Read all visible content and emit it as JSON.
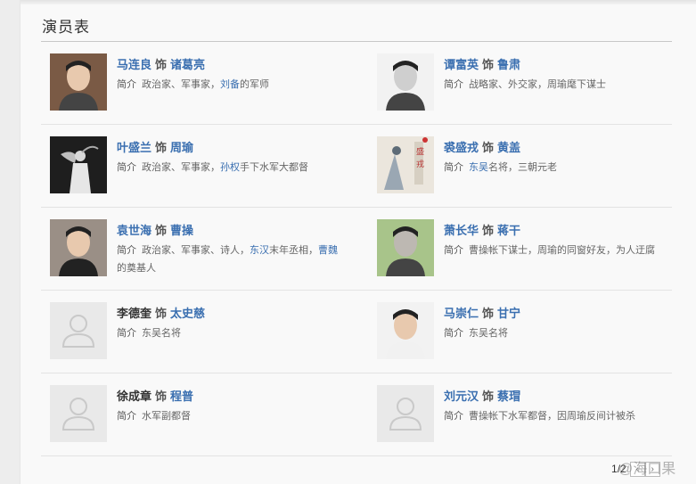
{
  "section": {
    "title": "演员表"
  },
  "cast": [
    {
      "actor": "马连良",
      "as": "饰",
      "role": "诸葛亮",
      "label": "简介",
      "desc": [
        {
          "t": "政治家、军事家，"
        },
        {
          "t": "刘备",
          "link": true
        },
        {
          "t": "的军师"
        }
      ],
      "photo": "portrait-photo"
    },
    {
      "actor": "谭富英",
      "as": "饰",
      "role": "鲁肃",
      "label": "简介",
      "desc": [
        {
          "t": "战略家、外交家，周瑜麾下谋士"
        }
      ],
      "photo": "portrait-photo"
    },
    {
      "actor": "叶盛兰",
      "as": "饰",
      "role": "周瑜",
      "label": "简介",
      "desc": [
        {
          "t": "政治家、军事家，"
        },
        {
          "t": "孙权",
          "link": true
        },
        {
          "t": "手下水军大都督"
        }
      ],
      "photo": "stage-photo"
    },
    {
      "actor": "裘盛戎",
      "as": "饰",
      "role": "黄盖",
      "label": "简介",
      "desc": [
        {
          "t": "东吴",
          "link": true
        },
        {
          "t": "名将，三朝元老"
        }
      ],
      "photo": "painting-photo"
    },
    {
      "actor": "袁世海",
      "as": "饰",
      "role": "曹操",
      "label": "简介",
      "desc": [
        {
          "t": "政治家、军事家、诗人，"
        },
        {
          "t": "东汉",
          "link": true
        },
        {
          "t": "末年丞相，"
        },
        {
          "t": "曹魏",
          "link": true
        },
        {
          "t": "的奠基人"
        }
      ],
      "photo": "portrait-photo"
    },
    {
      "actor": "萧长华",
      "as": "饰",
      "role": "蒋干",
      "label": "简介",
      "desc": [
        {
          "t": "曹操帐下谋士，周瑜的同窗好友，为人迂腐"
        }
      ],
      "photo": "portrait-photo"
    },
    {
      "actor": "李德奎",
      "as": "饰",
      "role": "太史慈",
      "label": "简介",
      "desc": [
        {
          "t": "东吴名将"
        }
      ],
      "photo": "placeholder"
    },
    {
      "actor": "马崇仁",
      "as": "饰",
      "role": "甘宁",
      "label": "简介",
      "desc": [
        {
          "t": "东吴名将"
        }
      ],
      "photo": "portrait-photo"
    },
    {
      "actor": "徐成章",
      "as": "饰",
      "role": "程普",
      "label": "简介",
      "desc": [
        {
          "t": "水军副都督"
        }
      ],
      "photo": "placeholder"
    },
    {
      "actor": "刘元汉",
      "as": "饰",
      "role": "蔡瑁",
      "label": "简介",
      "desc": [
        {
          "t": "曹操帐下水军都督，因周瑜反间计被杀"
        }
      ],
      "photo": "placeholder"
    }
  ],
  "pager": {
    "current": "1",
    "sep": "/",
    "total": "2",
    "prev": "‹",
    "next": "›"
  },
  "watermark": "@海口果"
}
